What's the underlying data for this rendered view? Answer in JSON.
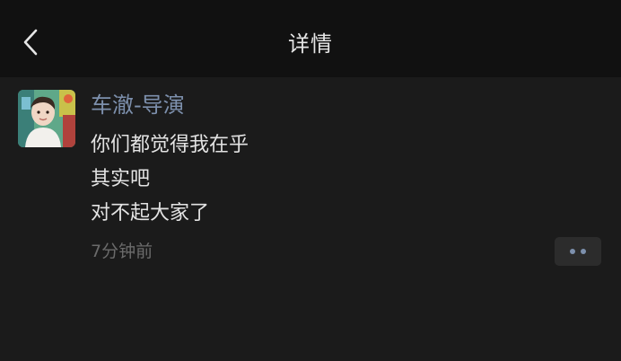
{
  "header": {
    "title": "详情",
    "back_icon": "chevron-left-icon"
  },
  "post": {
    "author": "车澈-导演",
    "lines": [
      "你们都觉得我在乎",
      "其实吧",
      "对不起大家了"
    ],
    "time": "7分钟前",
    "more_icon": "more-dots-icon"
  },
  "colors": {
    "header_bg": "#111111",
    "page_bg": "#1b1b1b",
    "author_name": "#7d90ad",
    "body_text": "#e3e3e3",
    "timestamp": "#6b6b6b"
  }
}
